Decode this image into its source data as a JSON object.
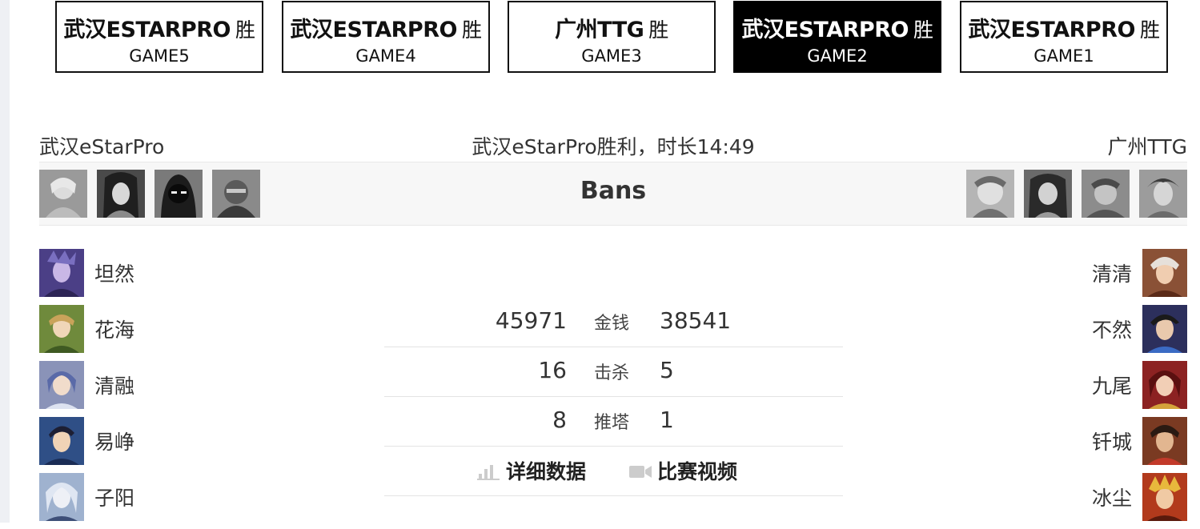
{
  "games": [
    {
      "winner": "武汉ESTARPRO",
      "win_mark": "胜",
      "label": "GAME5",
      "active": false
    },
    {
      "winner": "武汉ESTARPRO",
      "win_mark": "胜",
      "label": "GAME4",
      "active": false
    },
    {
      "winner": "广州TTG",
      "win_mark": "胜",
      "label": "GAME3",
      "active": false
    },
    {
      "winner": "武汉ESTARPRO",
      "win_mark": "胜",
      "label": "GAME2",
      "active": true
    },
    {
      "winner": "武汉ESTARPRO",
      "win_mark": "胜",
      "label": "GAME1",
      "active": false
    }
  ],
  "match": {
    "left_team": "武汉eStarPro",
    "result": "武汉eStarPro胜利，时长14:49",
    "right_team": "广州TTG"
  },
  "bans": {
    "title": "Bans",
    "left_icons": [
      "hero-ban-icon",
      "hero-ban-icon",
      "hero-ban-icon",
      "hero-ban-icon"
    ],
    "right_icons": [
      "hero-ban-icon",
      "hero-ban-icon",
      "hero-ban-icon",
      "hero-ban-icon"
    ]
  },
  "left_players": [
    {
      "name": "坦然",
      "avatar_color": "#4b3f86"
    },
    {
      "name": "花海",
      "avatar_color": "#6f8a3c"
    },
    {
      "name": "清融",
      "avatar_color": "#8a93b8"
    },
    {
      "name": "易峥",
      "avatar_color": "#2f4f86"
    },
    {
      "name": "子阳",
      "avatar_color": "#9fb2cf"
    }
  ],
  "right_players": [
    {
      "name": "清清",
      "avatar_color": "#8a5136"
    },
    {
      "name": "不然",
      "avatar_color": "#2c2f5c"
    },
    {
      "name": "九尾",
      "avatar_color": "#8c2222"
    },
    {
      "name": "钎城",
      "avatar_color": "#7a3a22"
    },
    {
      "name": "冰尘",
      "avatar_color": "#b23a1c"
    }
  ],
  "stats": [
    {
      "left": "45971",
      "label": "金钱",
      "right": "38541"
    },
    {
      "left": "16",
      "label": "击杀",
      "right": "5"
    },
    {
      "left": "8",
      "label": "推塔",
      "right": "1"
    }
  ],
  "actions": {
    "detail": {
      "label": "详细数据",
      "icon": "bar-chart-icon"
    },
    "video": {
      "label": "比赛视频",
      "icon": "video-camera-icon"
    }
  },
  "colors": {
    "active_tab_bg": "#000000",
    "tab_border": "#111111",
    "bans_bg": "#f7f7f7",
    "icon_gray": "#cccccc"
  }
}
